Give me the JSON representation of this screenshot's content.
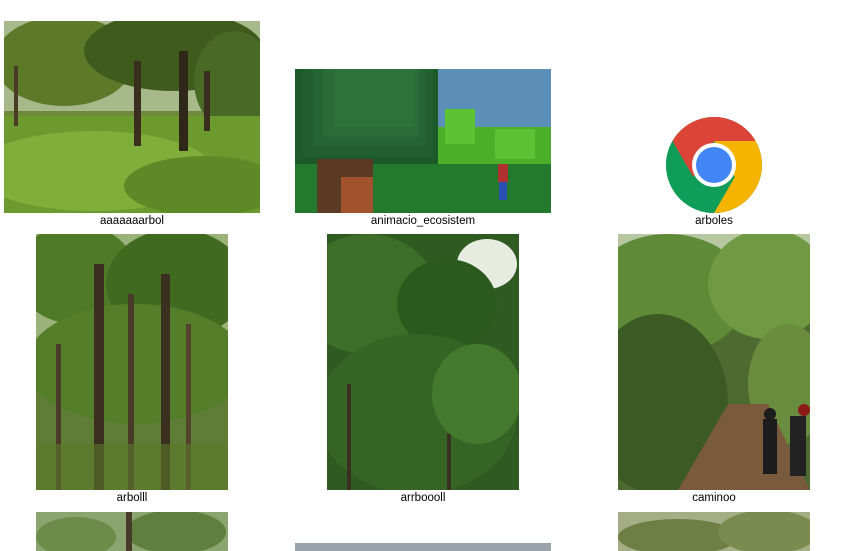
{
  "files": [
    {
      "name": "aaaaaaarbol",
      "kind": "photo"
    },
    {
      "name": "animacio_ecosistem",
      "kind": "game-render"
    },
    {
      "name": "arboles",
      "kind": "chrome-shortcut",
      "icon": "chrome-icon"
    },
    {
      "name": "arbolll",
      "kind": "photo"
    },
    {
      "name": "arrboooll",
      "kind": "photo"
    },
    {
      "name": "caminoo",
      "kind": "photo"
    },
    {
      "name": "",
      "kind": "photo-partial"
    },
    {
      "name": "",
      "kind": "photo-partial"
    },
    {
      "name": "",
      "kind": "photo-partial"
    }
  ],
  "colors": {
    "background": "#ffffff",
    "label_text": "#000000",
    "chrome_red": "#db4437",
    "chrome_yellow": "#f4b400",
    "chrome_green": "#0f9d58",
    "chrome_blue": "#4285f4"
  }
}
